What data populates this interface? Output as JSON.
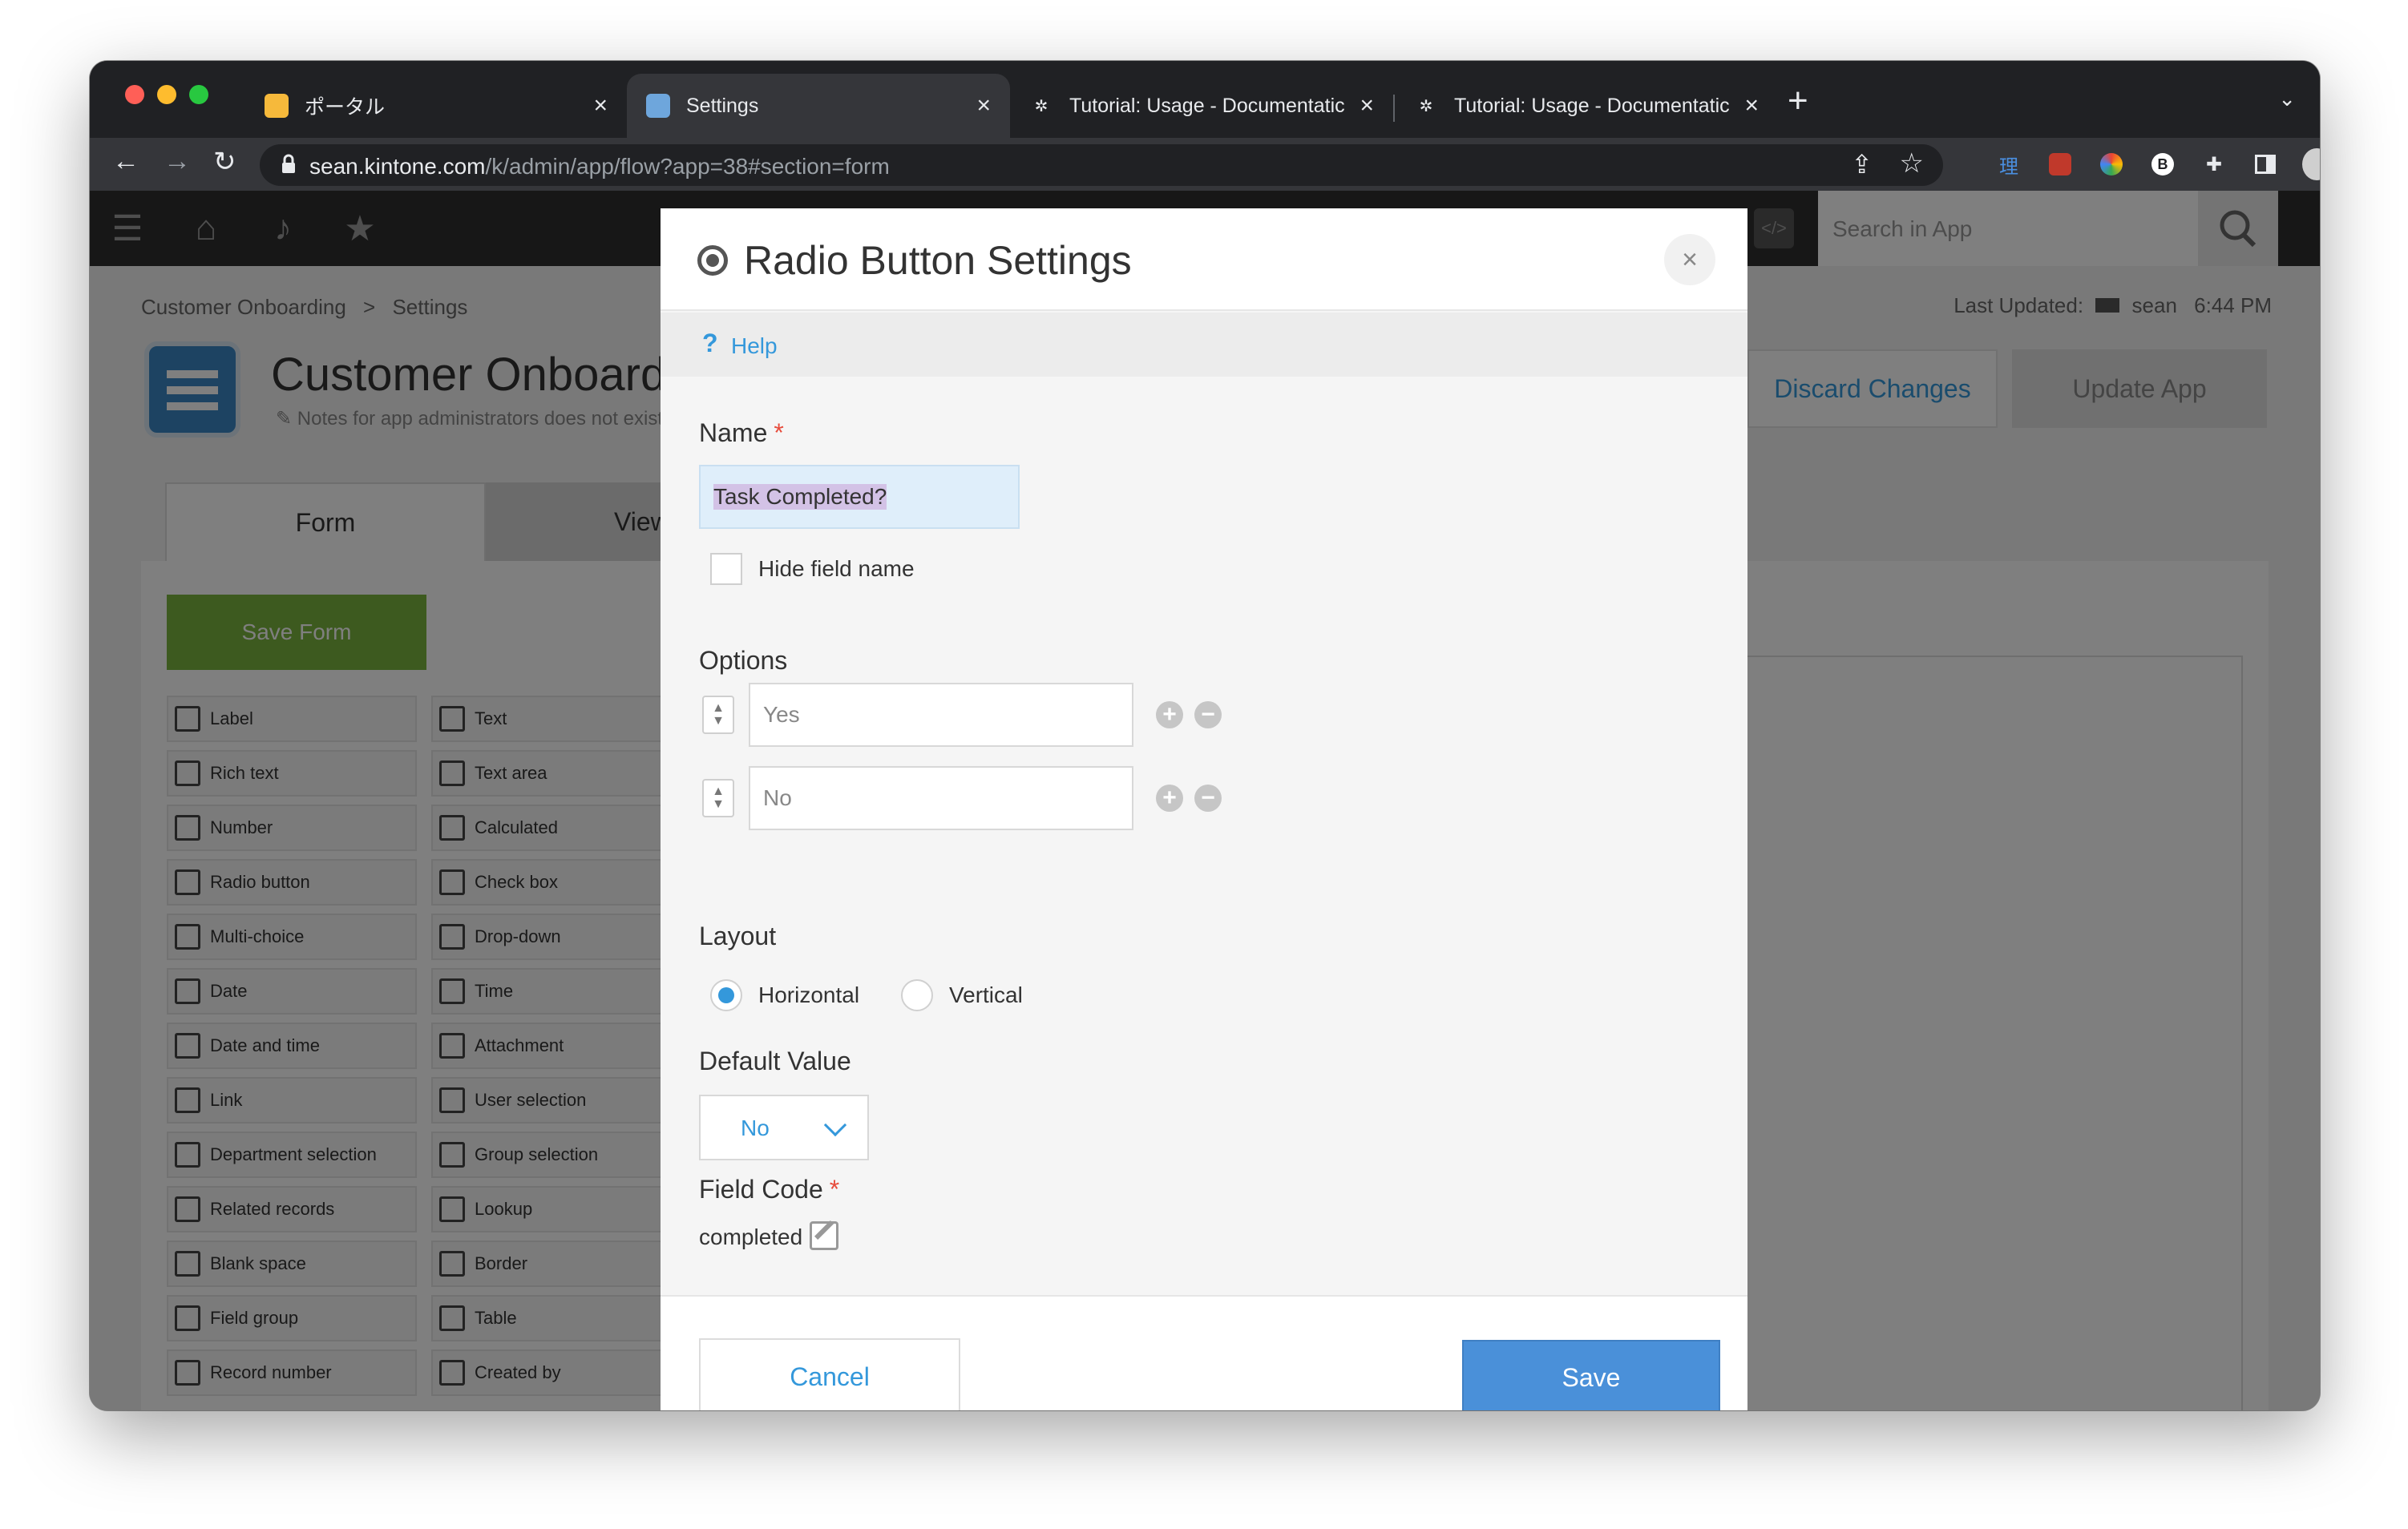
{
  "browser": {
    "tabs": [
      {
        "title": "ポータル",
        "icon": "kintone-portal-icon",
        "active": false
      },
      {
        "title": "Settings",
        "icon": "kintone-app-icon",
        "active": true
      },
      {
        "title": "Tutorial: Usage - Documentatic",
        "icon": "docs-icon",
        "active": false
      },
      {
        "title": "Tutorial: Usage - Documentatic",
        "icon": "docs-icon",
        "active": false
      }
    ],
    "url_host": "sean.kintone.com",
    "url_path": "/k/admin/app/flow?app=38#section=form",
    "extensions": [
      "share-icon",
      "star-icon",
      "理",
      "ublock-icon",
      "color-icon",
      "b-icon",
      "puzzle-icon",
      "sidebar-icon",
      "avatar",
      "more-icon"
    ]
  },
  "app": {
    "search_placeholder": "Search in App",
    "breadcrumb": [
      "Customer Onboarding",
      ">",
      "Settings"
    ],
    "last_updated_label": "Last Updated:",
    "last_updated_user": "sean",
    "last_updated_time": "6:44 PM",
    "title": "Customer Onboardi",
    "note": "Notes for app administrators does not exist",
    "discard_label": "Discard Changes",
    "update_label": "Update App",
    "tabs": {
      "form": "Form",
      "views": "View"
    },
    "save_form_label": "Save Form",
    "fields": [
      {
        "label": "Label"
      },
      {
        "label": "Text"
      },
      {
        "label": "Rich text"
      },
      {
        "label": "Text area"
      },
      {
        "label": "Number"
      },
      {
        "label": "Calculated"
      },
      {
        "label": "Radio button"
      },
      {
        "label": "Check box"
      },
      {
        "label": "Multi-choice"
      },
      {
        "label": "Drop-down"
      },
      {
        "label": "Date"
      },
      {
        "label": "Time"
      },
      {
        "label": "Date and time"
      },
      {
        "label": "Attachment"
      },
      {
        "label": "Link"
      },
      {
        "label": "User selection"
      },
      {
        "label": "Department selection"
      },
      {
        "label": "Group selection"
      },
      {
        "label": "Related records"
      },
      {
        "label": "Lookup"
      },
      {
        "label": "Blank space"
      },
      {
        "label": "Border"
      },
      {
        "label": "Field group"
      },
      {
        "label": "Table"
      },
      {
        "label": "Record number"
      },
      {
        "label": "Created by"
      }
    ]
  },
  "dialog": {
    "title": "Radio Button Settings",
    "close": "×",
    "help_label": "Help",
    "name_label": "Name",
    "required_mark": "*",
    "name_value": "Task Completed?",
    "hide_field_name_label": "Hide field name",
    "options_label": "Options",
    "options": [
      "Yes",
      "No"
    ],
    "layout_label": "Layout",
    "layout_options": [
      {
        "label": "Horizontal",
        "selected": true
      },
      {
        "label": "Vertical",
        "selected": false
      }
    ],
    "default_value_label": "Default Value",
    "default_value": "No",
    "field_code_label": "Field Code",
    "field_code_value": "completed",
    "cancel_label": "Cancel",
    "save_label": "Save"
  },
  "colors": {
    "accent": "#3498db",
    "save": "#4a90d9",
    "save_form": "#7ab43f",
    "required": "#e74c3c"
  }
}
